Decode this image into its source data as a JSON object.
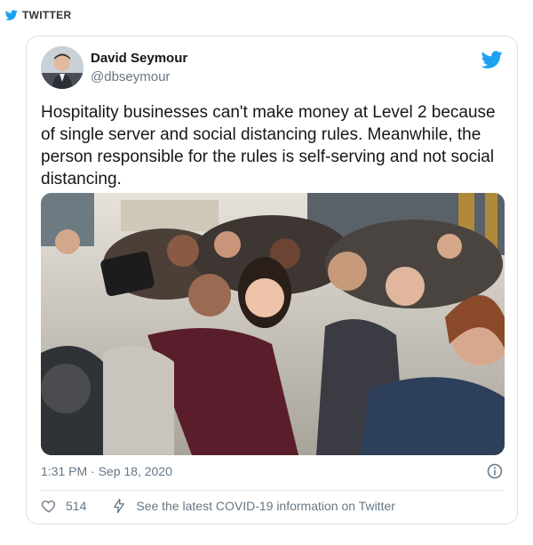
{
  "source": {
    "label": "TWITTER",
    "icon": "twitter-bird-icon"
  },
  "tweet": {
    "author_name": "David Seymour",
    "author_handle": "@dbseymour",
    "text": "Hospitality businesses can't make money at Level 2 because of single server and social distancing rules. Meanwhile, the person responsible for the rules is self-serving and not social distancing.",
    "timestamp": "1:31 PM · Sep 18, 2020",
    "like_count": "514",
    "covid_link": "See the latest COVID-19 information on Twitter"
  },
  "colors": {
    "twitter_blue": "#1da1f2",
    "secondary_text": "#657786",
    "border": "#d9dee3"
  }
}
